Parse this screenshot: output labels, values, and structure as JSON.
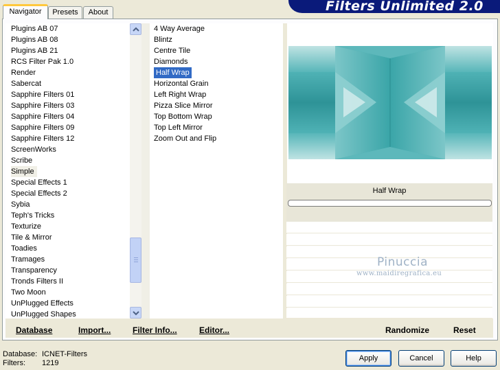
{
  "header": {
    "title": "Filters Unlimited 2.0"
  },
  "tabs": [
    {
      "label": "Navigator",
      "active": true
    },
    {
      "label": "Presets",
      "active": false
    },
    {
      "label": "About",
      "active": false
    }
  ],
  "categories": {
    "items": [
      "Plugins AB 07",
      "Plugins AB 08",
      "Plugins AB 21",
      "RCS Filter Pak 1.0",
      "Render",
      "Sabercat",
      "Sapphire Filters 01",
      "Sapphire Filters 03",
      "Sapphire Filters 04",
      "Sapphire Filters 09",
      "Sapphire Filters 12",
      "ScreenWorks",
      "Scribe",
      "Simple",
      "Special Effects 1",
      "Special Effects 2",
      "Sybia",
      "Teph's Tricks",
      "Texturize",
      "Tile & Mirror",
      "Toadies",
      "Tramages",
      "Transparency",
      "Tronds Filters II",
      "Two Moon",
      "UnPlugged Effects",
      "UnPlugged Shapes"
    ],
    "selected": "Simple"
  },
  "filters": {
    "items": [
      "4 Way Average",
      "Blintz",
      "Centre Tile",
      "Diamonds",
      "Half Wrap",
      "Horizontal Grain",
      "Left Right Wrap",
      "Pizza Slice Mirror",
      "Top Bottom Wrap",
      "Top Left Mirror",
      "Zoom Out and Flip"
    ],
    "selected": "Half Wrap"
  },
  "left_actions": {
    "database": "Database",
    "import": "Import...",
    "filter_info": "Filter Info...",
    "editor": "Editor..."
  },
  "preview": {
    "filter_name": "Half Wrap",
    "randomize": "Randomize",
    "reset": "Reset",
    "progress": 0
  },
  "watermark": {
    "line1": "Pinuccia",
    "line2": "www.maidiregrafica.eu"
  },
  "footer": {
    "database_label": "Database:",
    "database_value": "ICNET-Filters",
    "filters_label": "Filters:",
    "filters_value": "1219"
  },
  "buttons": {
    "apply": "Apply",
    "cancel": "Cancel",
    "help": "Help"
  },
  "colors": {
    "selection": "#316ac5",
    "banner": "#0a1a7a",
    "preview_teal": "#56b5b8",
    "preview_dark": "#2e9397"
  }
}
